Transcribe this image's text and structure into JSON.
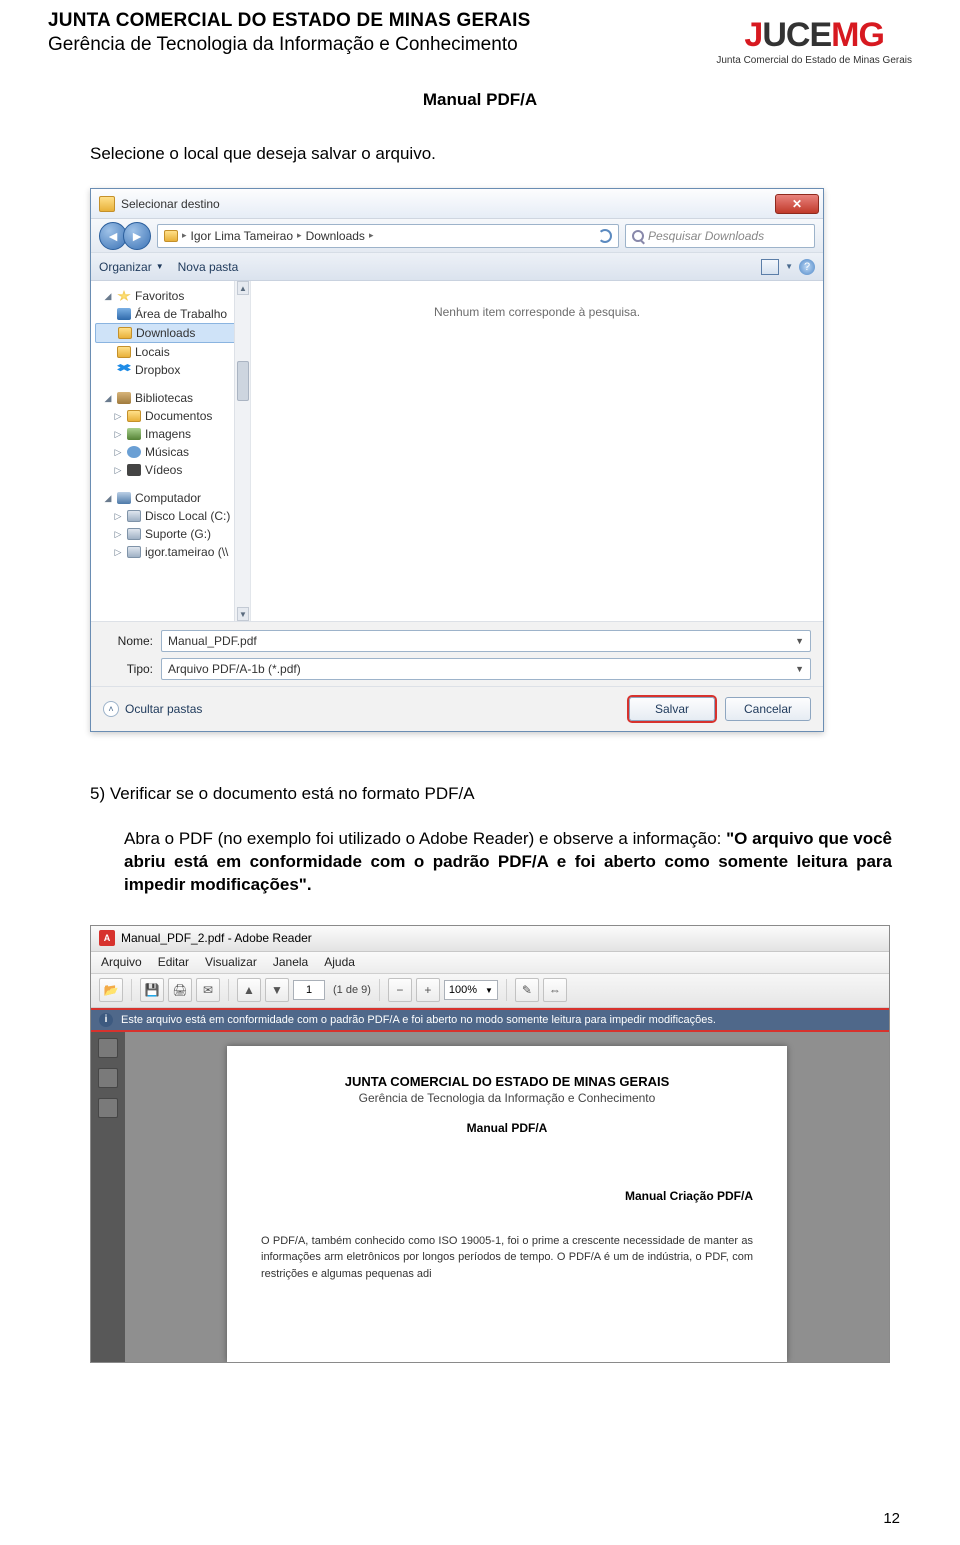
{
  "header": {
    "org": "JUNTA COMERCIAL DO ESTADO DE MINAS GERAIS",
    "dept": "Gerência de Tecnologia da Informação e Conhecimento",
    "logo_main": "JUCEMG",
    "logo_sub": "Junta Comercial do Estado de Minas Gerais"
  },
  "manual_title": "Manual PDF/A",
  "instruction1": "Selecione o local que deseja salvar o arquivo.",
  "dialog": {
    "title": "Selecionar destino",
    "breadcrumb": {
      "p1": "Igor Lima Tameirao",
      "p2": "Downloads"
    },
    "search_placeholder": "Pesquisar Downloads",
    "organize": "Organizar",
    "new_folder": "Nova pasta",
    "tree": {
      "favorites": "Favoritos",
      "desktop": "Área de Trabalho",
      "downloads": "Downloads",
      "locals": "Locais",
      "dropbox": "Dropbox",
      "libraries": "Bibliotecas",
      "documents": "Documentos",
      "images": "Imagens",
      "music": "Músicas",
      "videos": "Vídeos",
      "computer": "Computador",
      "drive_c": "Disco Local (C:)",
      "drive_g": "Suporte (G:)",
      "drive_net": "igor.tameirao (\\\\"
    },
    "empty_msg": "Nenhum item corresponde à pesquisa.",
    "name_label": "Nome:",
    "name_value": "Manual_PDF.pdf",
    "type_label": "Tipo:",
    "type_value": "Arquivo PDF/A-1b (*.pdf)",
    "hide_folders": "Ocultar pastas",
    "save": "Salvar",
    "cancel": "Cancelar"
  },
  "step5": {
    "line1": "5)  Verificar se o documento está no formato PDF/A",
    "body_pre": "Abra o PDF (no exemplo foi utilizado o Adobe Reader) e observe a informação: ",
    "body_quote": "\"O arquivo que você abriu está em conformidade com o padrão PDF/A e foi aberto como somente leitura para impedir modificações\"."
  },
  "reader": {
    "title": "Manual_PDF_2.pdf - Adobe Reader",
    "menu": [
      "Arquivo",
      "Editar",
      "Visualizar",
      "Janela",
      "Ajuda"
    ],
    "page_current": "1",
    "page_total": "(1 de 9)",
    "zoom": "100%",
    "info_msg": "Este arquivo está em conformidade com o padrão PDF/A e foi aberto no modo somente leitura para impedir modificações.",
    "page": {
      "h1": "JUNTA COMERCIAL DO ESTADO DE MINAS GERAIS",
      "h2": "Gerência de Tecnologia da Informação e Conhecimento",
      "manual": "Manual PDF/A",
      "section": "Manual Criação PDF/A",
      "para": "O PDF/A, também conhecido como ISO 19005-1, foi o prime a crescente necessidade de manter as informações arm eletrônicos por longos períodos de tempo. O PDF/A é um de indústria, o PDF, com restrições e algumas pequenas adi"
    }
  },
  "page_number": "12"
}
